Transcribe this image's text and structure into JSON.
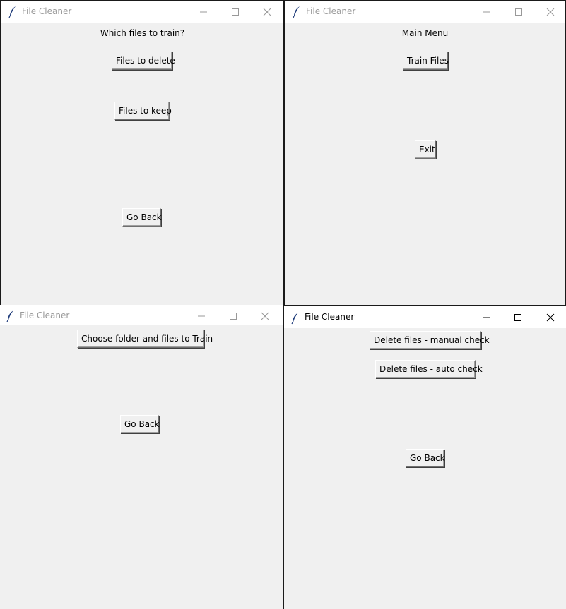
{
  "windows": {
    "train_select": {
      "title": "File Cleaner",
      "prompt": "Which files to train?",
      "buttons": {
        "delete": "Files to delete",
        "keep": "Files to keep",
        "back": "Go Back"
      }
    },
    "main_menu": {
      "title": "File Cleaner",
      "heading": "Main Menu",
      "buttons": {
        "train": "Train Files",
        "exit": "Exit"
      }
    },
    "choose_folder": {
      "title": "File Cleaner",
      "buttons": {
        "choose": "Choose folder and files to Train",
        "back": "Go Back"
      }
    },
    "delete_menu": {
      "title": "File Cleaner",
      "buttons": {
        "manual": "Delete files - manual check",
        "auto": "Delete files - auto check",
        "back": "Go Back"
      }
    }
  },
  "icons": {
    "app": "feather-icon",
    "minimize": "minimize-icon",
    "maximize": "maximize-icon",
    "close": "close-icon"
  },
  "colors": {
    "window_bg": "#f0f0f0",
    "titlebar_bg": "#ffffff",
    "inactive_title": "#999999",
    "active_title": "#000000"
  }
}
